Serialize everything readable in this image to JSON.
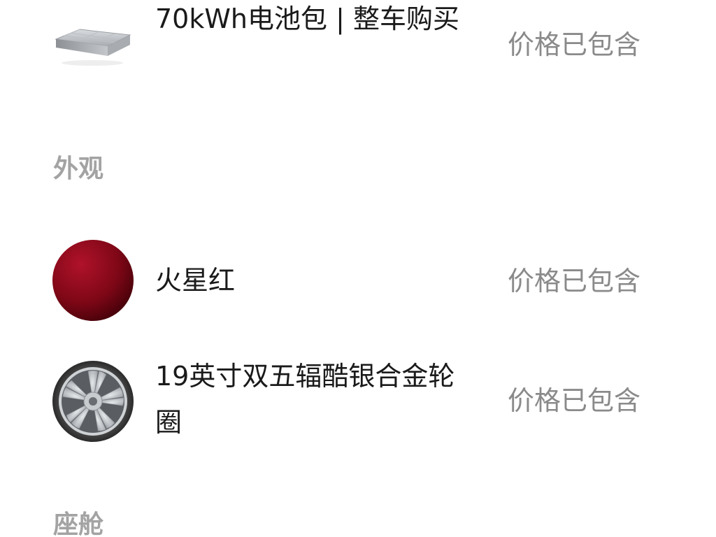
{
  "battery": {
    "name": "70kWh电池包 | 整车购买",
    "price_note": "价格已包含"
  },
  "exterior": {
    "title": "外观",
    "items": [
      {
        "name": "火星红",
        "price_note": "价格已包含",
        "swatch_color": "#8b0a1a"
      },
      {
        "name": "19英寸双五辐酷银合金轮圈",
        "price_note": "价格已包含"
      }
    ]
  },
  "cabin": {
    "title": "座舱"
  }
}
